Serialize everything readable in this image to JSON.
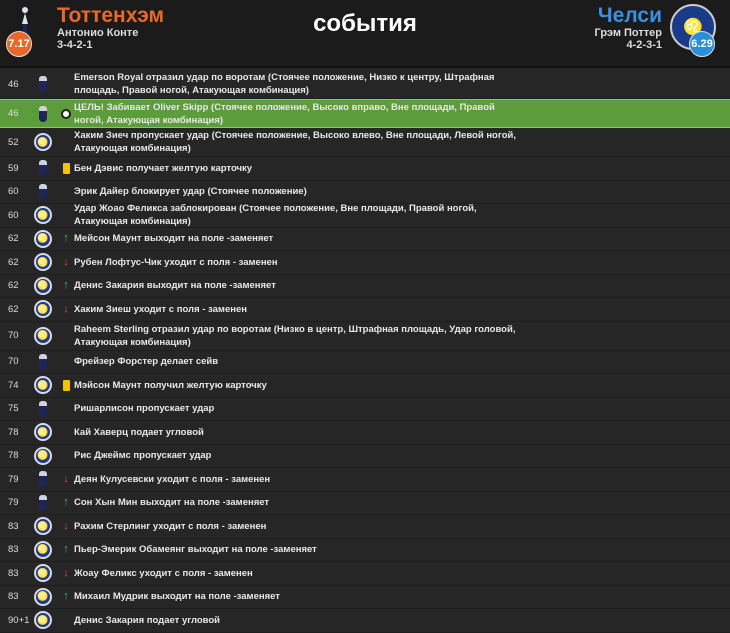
{
  "header": {
    "title": "события",
    "home": {
      "name": "Тоттенхэм",
      "coach": "Антонио Конте",
      "formation": "3-4-2-1",
      "rating": "7.17"
    },
    "away": {
      "name": "Челси",
      "coach": "Грэм Поттер",
      "formation": "4-2-3-1",
      "rating": "6.29"
    }
  },
  "colors": {
    "home": "#e8682a",
    "away": "#2a8fd9",
    "goal_row": "#5d9c3b"
  },
  "events": [
    {
      "minute": "46",
      "team": "spurs",
      "icon": "",
      "text": "Emerson Royal отразил удар по воротам (Стоячее положение, Низко к центру, Штрафная площадь, Правой ногой, Атакующая комбинация)"
    },
    {
      "minute": "46",
      "team": "spurs",
      "icon": "goal-ball-icon",
      "text": "ЦЕЛЬ! Забивает Oliver Skipp (Стоячее положение, Высоко вправо, Вне площади, Правой ногой, Атакующая комбинация)"
    },
    {
      "minute": "52",
      "team": "chelsea",
      "icon": "",
      "text": "Хаким Зиеч пропускает удар (Стоячее положение, Высоко влево, Вне площади, Левой ногой, Атакующая комбинация)"
    },
    {
      "minute": "59",
      "team": "spurs",
      "icon": "yellow-card-icon",
      "text": "Бен Дэвис получает желтую карточку"
    },
    {
      "minute": "60",
      "team": "spurs",
      "icon": "",
      "text": "Эрик Дайер блокирует удар (Стоячее положение)"
    },
    {
      "minute": "60",
      "team": "chelsea",
      "icon": "",
      "text": "Удар Жоао Феликса заблокирован (Стоячее положение, Вне площади, Правой ногой, Атакующая комбинация)"
    },
    {
      "minute": "62",
      "team": "chelsea",
      "icon": "sub-in-icon",
      "text": "Мейсон Маунт выходит на поле -заменяет"
    },
    {
      "minute": "62",
      "team": "chelsea",
      "icon": "sub-out-icon",
      "text": "Рубен Лофтус-Чик уходит с поля - заменен"
    },
    {
      "minute": "62",
      "team": "chelsea",
      "icon": "sub-in-icon",
      "text": "Денис Закария выходит на поле -заменяет"
    },
    {
      "minute": "62",
      "team": "chelsea",
      "icon": "sub-out-icon",
      "text": "Хаким Зиеш уходит с поля - заменен"
    },
    {
      "minute": "70",
      "team": "chelsea",
      "icon": "",
      "text": "Raheem Sterling отразил удар по воротам (Низко в центр, Штрафная площадь, Удар головой, Атакующая комбинация)"
    },
    {
      "minute": "70",
      "team": "spurs",
      "icon": "",
      "text": "Фрейзер Форстер делает сейв"
    },
    {
      "minute": "74",
      "team": "chelsea",
      "icon": "yellow-card-icon",
      "text": "Мэйсон Маунт получил желтую карточку"
    },
    {
      "minute": "75",
      "team": "spurs",
      "icon": "",
      "text": "Ришарлисон пропускает удар"
    },
    {
      "minute": "78",
      "team": "chelsea",
      "icon": "",
      "text": "Кай Хаверц подает угловой"
    },
    {
      "minute": "78",
      "team": "chelsea",
      "icon": "",
      "text": "Рис Джеймс пропускает удар"
    },
    {
      "minute": "79",
      "team": "spurs",
      "icon": "sub-out-icon",
      "text": "Деян Кулусевски уходит с поля - заменен"
    },
    {
      "minute": "79",
      "team": "spurs",
      "icon": "sub-in-icon",
      "text": "Сон Хын Мин выходит на поле -заменяет"
    },
    {
      "minute": "83",
      "team": "chelsea",
      "icon": "sub-out-icon",
      "text": "Рахим Стерлинг уходит с поля - заменен"
    },
    {
      "minute": "83",
      "team": "chelsea",
      "icon": "sub-in-icon",
      "text": "Пьер-Эмерик Обамеянг выходит на поле -заменяет"
    },
    {
      "minute": "83",
      "team": "chelsea",
      "icon": "sub-out-icon",
      "text": "Жоау Феликс уходит с поля - заменен"
    },
    {
      "minute": "83",
      "team": "chelsea",
      "icon": "sub-in-icon",
      "text": "Михаил Мудрик выходит на поле -заменяет"
    },
    {
      "minute": "90+1",
      "team": "chelsea",
      "icon": "",
      "text": "Денис Закария подает угловой"
    }
  ]
}
